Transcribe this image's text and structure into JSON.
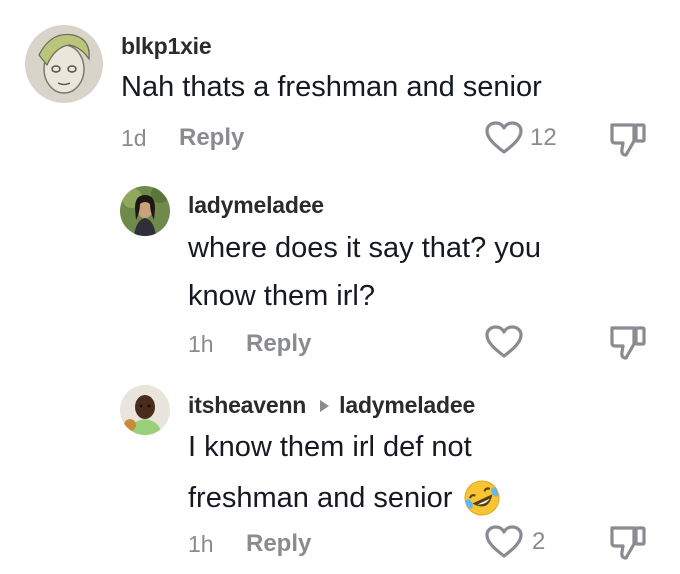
{
  "comments": [
    {
      "username": "blkp1xie",
      "text": "Nah thats a freshman and senior",
      "time": "1d",
      "reply_label": "Reply",
      "like_count": "12"
    },
    {
      "username": "ladymeladee",
      "text_line1": "where does it say that? you",
      "text_line2": "know them irl?",
      "time": "1h",
      "reply_label": "Reply",
      "like_count": ""
    },
    {
      "username": "itsheavenn",
      "reply_to": "ladymeladee",
      "text_line1": "I know them irl def not",
      "text_line2": "freshman and senior",
      "emoji": "rolling-on-floor-laughing-emoji",
      "time": "1h",
      "reply_label": "Reply",
      "like_count": "2"
    }
  ],
  "colors": {
    "text": "#161823",
    "secondary": "#8a8b91",
    "username": "#2b2b2b"
  },
  "icons": [
    "heart-outline-icon",
    "thumbs-down-icon",
    "caret-right-icon"
  ]
}
